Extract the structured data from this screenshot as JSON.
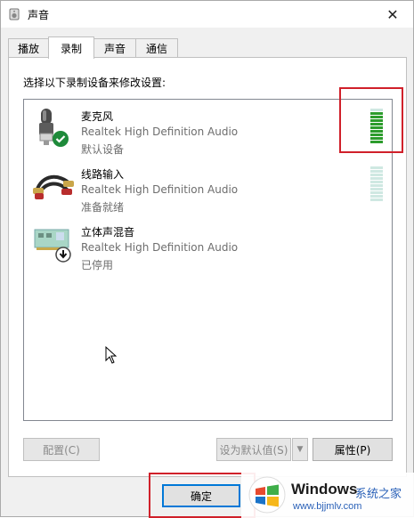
{
  "window": {
    "title": "声音",
    "close_glyph": "✕"
  },
  "tabs": [
    {
      "label": "播放",
      "active": false
    },
    {
      "label": "录制",
      "active": true
    },
    {
      "label": "声音",
      "active": false
    },
    {
      "label": "通信",
      "active": false
    }
  ],
  "panel": {
    "instruction": "选择以下录制设备来修改设置:"
  },
  "devices": [
    {
      "name": "麦克风",
      "driver": "Realtek High Definition Audio",
      "status": "默认设备",
      "icon": "microphone-icon",
      "badge": "check-badge-icon",
      "meter_level": 0.9
    },
    {
      "name": "线路输入",
      "driver": "Realtek High Definition Audio",
      "status": "准备就绪",
      "icon": "line-in-cable-icon",
      "meter_level": 0
    },
    {
      "name": "立体声混音",
      "driver": "Realtek High Definition Audio",
      "status": "已停用",
      "icon": "sound-card-icon",
      "badge": "disabled-arrow-badge-icon"
    }
  ],
  "buttons": {
    "configure": "配置(C)",
    "set_default": "设为默认值(S)",
    "properties": "属性(P)",
    "ok": "确定"
  },
  "watermark": {
    "title": "Windows",
    "subtitle": "系统之家",
    "url": "www.bjjmlv.com"
  },
  "colors": {
    "meter_active": "#2d9c2d",
    "meter_inactive": "#cfe8e2",
    "highlight": "#d0202a",
    "check_badge": "#1e8a3a"
  }
}
